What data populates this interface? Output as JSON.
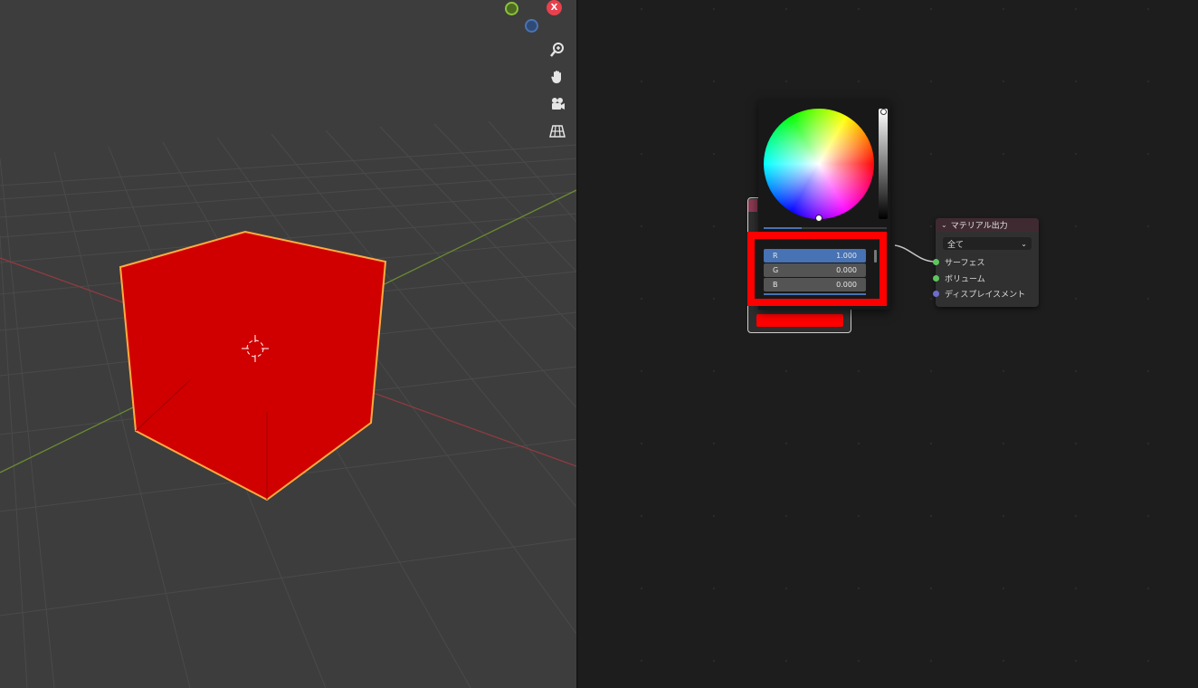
{
  "gizmo": {
    "x_axis_label": "X",
    "x_color": "#e8414d",
    "y_color": "#8cc43a",
    "z_color": "#4a73b5"
  },
  "nav_buttons": [
    {
      "icon": "zoom-icon"
    },
    {
      "icon": "hand-pan-icon"
    },
    {
      "icon": "camera-icon"
    },
    {
      "icon": "grid-view-icon"
    }
  ],
  "viewport": {
    "cube_color": "#d00000",
    "outline_color": "#ffaa40",
    "background": "#3d3d3d"
  },
  "color_picker": {
    "r_label": "R",
    "r_value": "1.000",
    "g_label": "G",
    "g_value": "0.000",
    "b_label": "B",
    "b_value": "0.000",
    "swatch_color": "#ff0000"
  },
  "material_output": {
    "title": "マテリアル出力",
    "target": "全て",
    "sockets": [
      {
        "label": "サーフェス",
        "color": "#5ec55e"
      },
      {
        "label": "ボリューム",
        "color": "#5ec55e"
      },
      {
        "label": "ディスプレイスメント",
        "color": "#6d6dcf"
      }
    ]
  }
}
